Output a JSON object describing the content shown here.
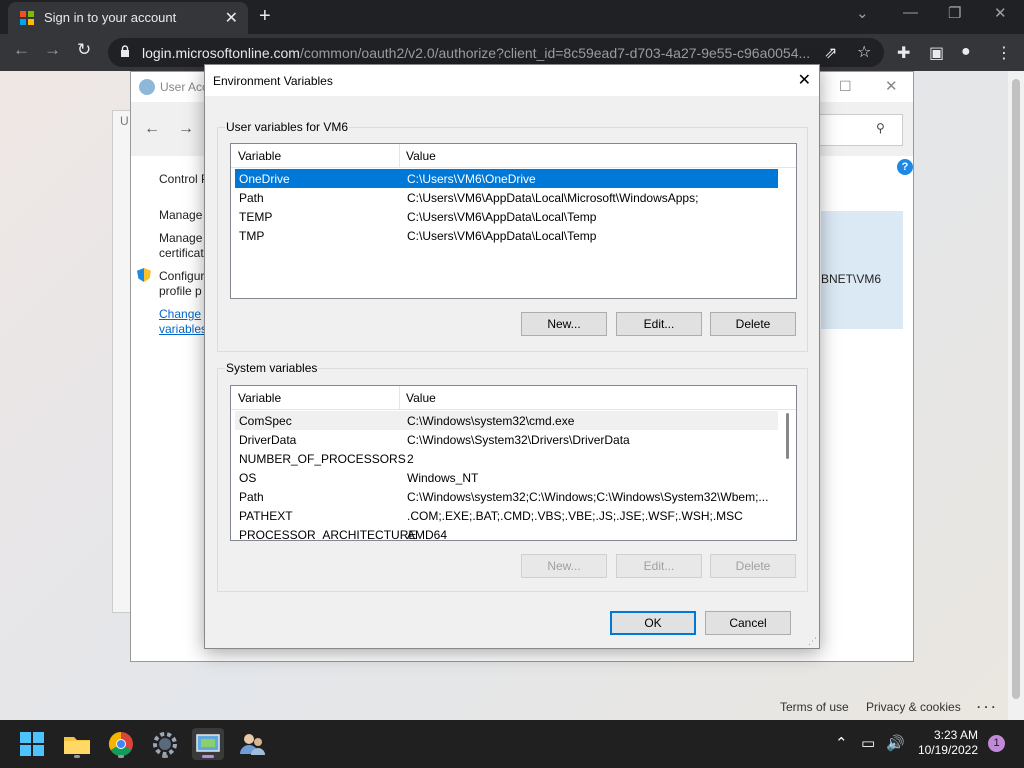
{
  "browser": {
    "tab_title": "Sign in to your account",
    "url_host": "login.microsoftonline.com",
    "url_path": "/common/oauth2/v2.0/authorize?client_id=8c59ead7-d703-4a27-9e55-c96a0054..."
  },
  "user_accounts": {
    "title_fragment": "User Acco",
    "back_fragment": "U",
    "sidebar": [
      {
        "label": "Control P"
      },
      {
        "label": "Manage"
      },
      {
        "label": "Manage\ncertificat"
      },
      {
        "label": "Configur\nprofile p"
      },
      {
        "label": "Change\nvariables"
      }
    ],
    "panel_text": "BNET\\VM6"
  },
  "dialog": {
    "title": "Environment Variables",
    "user_group_label": "User variables for VM6",
    "system_group_label": "System variables",
    "columns": {
      "variable": "Variable",
      "value": "Value"
    },
    "user_vars": [
      {
        "name": "OneDrive",
        "value": "C:\\Users\\VM6\\OneDrive",
        "selected": true
      },
      {
        "name": "Path",
        "value": "C:\\Users\\VM6\\AppData\\Local\\Microsoft\\WindowsApps;"
      },
      {
        "name": "TEMP",
        "value": "C:\\Users\\VM6\\AppData\\Local\\Temp"
      },
      {
        "name": "TMP",
        "value": "C:\\Users\\VM6\\AppData\\Local\\Temp"
      }
    ],
    "system_vars": [
      {
        "name": "ComSpec",
        "value": "C:\\Windows\\system32\\cmd.exe"
      },
      {
        "name": "DriverData",
        "value": "C:\\Windows\\System32\\Drivers\\DriverData"
      },
      {
        "name": "NUMBER_OF_PROCESSORS",
        "value": "2"
      },
      {
        "name": "OS",
        "value": "Windows_NT"
      },
      {
        "name": "Path",
        "value": "C:\\Windows\\system32;C:\\Windows;C:\\Windows\\System32\\Wbem;..."
      },
      {
        "name": "PATHEXT",
        "value": ".COM;.EXE;.BAT;.CMD;.VBS;.VBE;.JS;.JSE;.WSF;.WSH;.MSC"
      },
      {
        "name": "PROCESSOR_ARCHITECTURE",
        "value": "AMD64"
      }
    ],
    "buttons": {
      "new": "New...",
      "edit": "Edit...",
      "delete": "Delete",
      "ok": "OK",
      "cancel": "Cancel"
    }
  },
  "footer": {
    "terms": "Terms of use",
    "privacy": "Privacy & cookies",
    "more": "· · ·"
  },
  "taskbar": {
    "time": "3:23 AM",
    "date": "10/19/2022",
    "notification_count": "1"
  },
  "colors": {
    "selection": "#0078d7",
    "taskbar": "#202020",
    "browser_frame": "#202124"
  }
}
